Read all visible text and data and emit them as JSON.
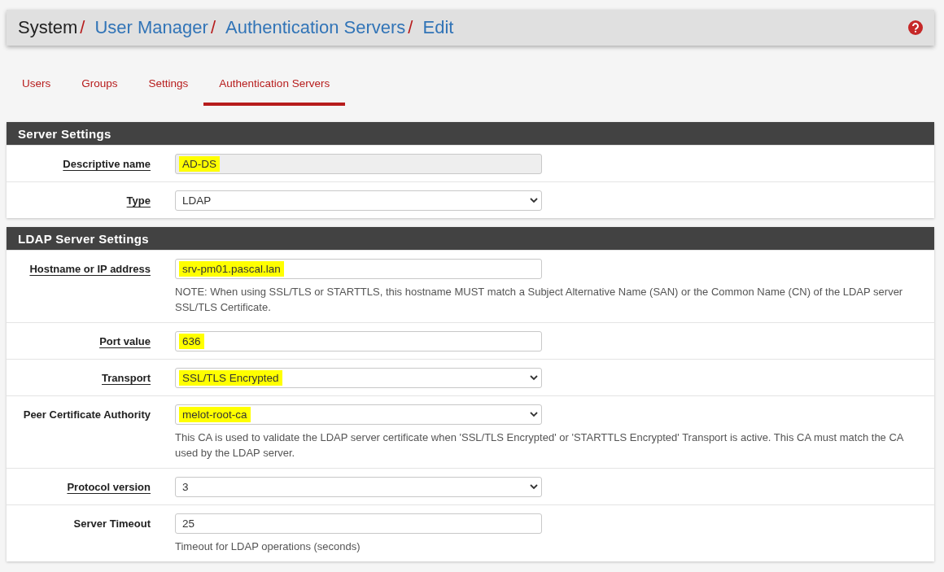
{
  "breadcrumb": [
    {
      "label": "System",
      "link": false
    },
    {
      "label": "User Manager",
      "link": true
    },
    {
      "label": "Authentication Servers",
      "link": true
    },
    {
      "label": "Edit",
      "link": true
    }
  ],
  "separator": "/",
  "tabs": [
    {
      "label": "Users",
      "selected": false
    },
    {
      "label": "Groups",
      "selected": false
    },
    {
      "label": "Settings",
      "selected": false
    },
    {
      "label": "Authentication Servers",
      "selected": true
    }
  ],
  "panels": [
    {
      "title": "Server Settings",
      "rows": [
        {
          "label": "Descriptive name",
          "underlined": true,
          "kind": "input",
          "value": "AD-DS",
          "disabled": true,
          "highlighted": true
        },
        {
          "label": "Type",
          "underlined": true,
          "kind": "select",
          "value": "LDAP",
          "disabled": false,
          "highlighted": false
        }
      ]
    },
    {
      "title": "LDAP Server Settings",
      "rows": [
        {
          "label": "Hostname or IP address",
          "underlined": true,
          "kind": "input",
          "value": "srv-pm01.pascal.lan",
          "disabled": false,
          "highlighted": true,
          "help": "NOTE: When using SSL/TLS or STARTTLS, this hostname MUST match a Subject Alternative Name (SAN) or the Common Name (CN) of the LDAP server SSL/TLS Certificate."
        },
        {
          "label": "Port value",
          "underlined": true,
          "kind": "input",
          "value": "636",
          "disabled": false,
          "highlighted": true
        },
        {
          "label": "Transport",
          "underlined": true,
          "kind": "select",
          "value": "SSL/TLS Encrypted",
          "disabled": false,
          "highlighted": true
        },
        {
          "label": "Peer Certificate Authority",
          "underlined": false,
          "kind": "select",
          "value": "melot-root-ca",
          "disabled": false,
          "highlighted": true,
          "help": "This CA is used to validate the LDAP server certificate when 'SSL/TLS Encrypted' or 'STARTTLS Encrypted' Transport is active. This CA must match the CA used by the LDAP server."
        },
        {
          "label": "Protocol version",
          "underlined": true,
          "kind": "select",
          "value": "3",
          "disabled": false,
          "highlighted": false
        },
        {
          "label": "Server Timeout",
          "underlined": false,
          "kind": "input",
          "value": "25",
          "disabled": false,
          "highlighted": false,
          "help": "Timeout for LDAP operations (seconds)"
        }
      ]
    }
  ]
}
